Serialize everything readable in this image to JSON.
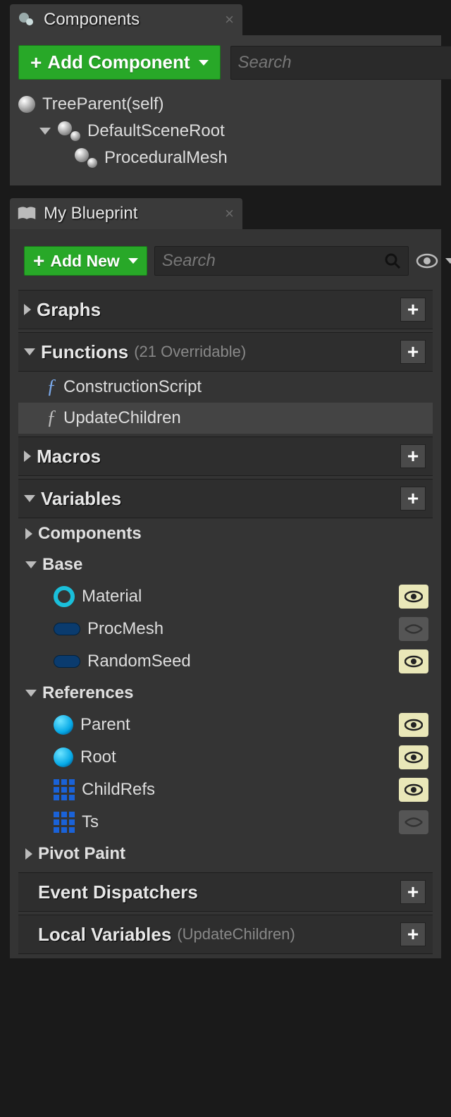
{
  "components": {
    "tab_title": "Components",
    "add_button": "Add Component",
    "search_placeholder": "Search",
    "tree": {
      "root": "TreeParent(self)",
      "scene_root": "DefaultSceneRoot",
      "child": "ProceduralMesh"
    }
  },
  "blueprint": {
    "tab_title": "My Blueprint",
    "add_button": "Add New",
    "search_placeholder": "Search",
    "sections": {
      "graphs": {
        "label": "Graphs"
      },
      "functions": {
        "label": "Functions",
        "sub": "(21 Overridable)",
        "items": {
          "construction": "ConstructionScript",
          "update": "UpdateChildren"
        }
      },
      "macros": {
        "label": "Macros"
      },
      "variables": {
        "label": "Variables",
        "groups": {
          "components": "Components",
          "base": {
            "label": "Base",
            "items": {
              "material": "Material",
              "procmesh": "ProcMesh",
              "randomseed": "RandomSeed"
            }
          },
          "references": {
            "label": "References",
            "items": {
              "parent": "Parent",
              "root": "Root",
              "childrefs": "ChildRefs",
              "ts": "Ts"
            }
          },
          "pivotpaint": "Pivot Paint"
        }
      },
      "dispatchers": {
        "label": "Event Dispatchers"
      },
      "locals": {
        "label": "Local Variables",
        "sub": "(UpdateChildren)"
      }
    }
  }
}
